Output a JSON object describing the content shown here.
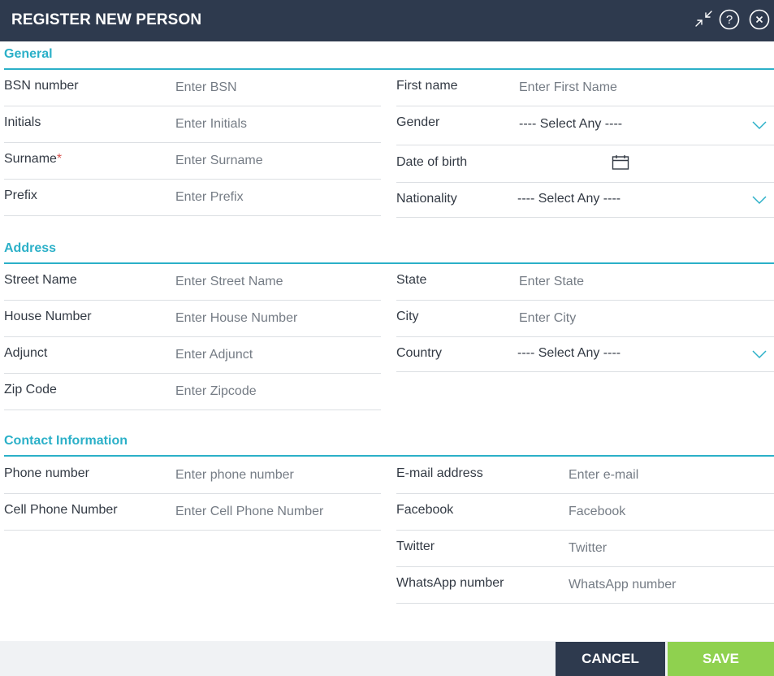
{
  "dialog": {
    "title": "REGISTER NEW PERSON",
    "icons": [
      "collapse-icon",
      "help-icon",
      "close-icon"
    ]
  },
  "general": {
    "title": "General",
    "bsn": {
      "label": "BSN number",
      "placeholder": "Enter BSN"
    },
    "initials": {
      "label": "Initials",
      "placeholder": "Enter Initials"
    },
    "surname": {
      "label": "Surname",
      "required_mark": "*",
      "placeholder": "Enter Surname"
    },
    "prefix": {
      "label": "Prefix",
      "placeholder": "Enter Prefix"
    },
    "first_name": {
      "label": "First name",
      "placeholder": "Enter First Name"
    },
    "gender": {
      "label": "Gender",
      "value": "---- Select Any ----"
    },
    "dob": {
      "label": "Date of birth",
      "icon": "calendar-icon"
    },
    "nationality": {
      "label": "Nationality",
      "value": "---- Select Any ----"
    }
  },
  "address": {
    "title": "Address",
    "street": {
      "label": "Street Name",
      "placeholder": "Enter Street Name"
    },
    "house_number": {
      "label": "House Number",
      "placeholder": "Enter House Number"
    },
    "adjunct": {
      "label": "Adjunct",
      "placeholder": "Enter Adjunct"
    },
    "zip": {
      "label": "Zip Code",
      "placeholder": "Enter Zipcode"
    },
    "state": {
      "label": "State",
      "placeholder": "Enter State"
    },
    "city": {
      "label": "City",
      "placeholder": "Enter City"
    },
    "country": {
      "label": "Country",
      "value": "---- Select Any ----"
    }
  },
  "contact": {
    "title": "Contact Information",
    "phone": {
      "label": "Phone number",
      "placeholder": "Enter phone number"
    },
    "cell": {
      "label": "Cell Phone Number",
      "placeholder": "Enter Cell Phone Number"
    },
    "email": {
      "label": "E-mail address",
      "placeholder": "Enter e-mail"
    },
    "facebook": {
      "label": "Facebook",
      "placeholder": "Facebook"
    },
    "twitter": {
      "label": "Twitter",
      "placeholder": "Twitter"
    },
    "whatsapp": {
      "label": "WhatsApp number",
      "placeholder": "WhatsApp number"
    }
  },
  "footer": {
    "cancel_label": "CANCEL",
    "save_label": "SAVE"
  },
  "colors": {
    "header_bg": "#2e3a4e",
    "accent": "#2bb0c8",
    "save": "#8fd14f",
    "cancel": "#2e3a4e"
  }
}
